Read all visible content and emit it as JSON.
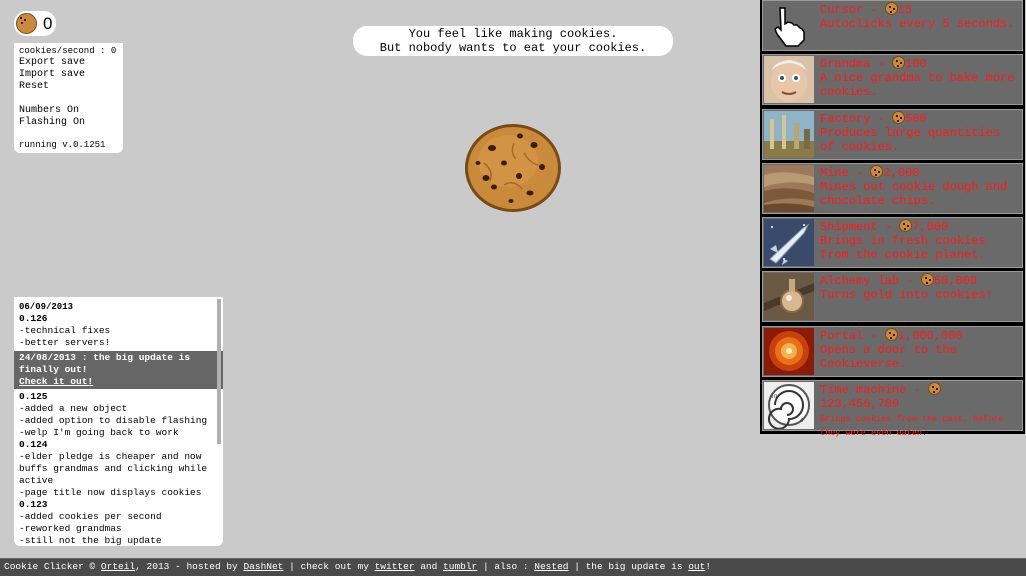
{
  "counter": {
    "value": "0"
  },
  "menu": {
    "cps": "cookies/second : 0",
    "export": "Export save",
    "import": "Import save",
    "reset": "Reset",
    "numbers": "Numbers On",
    "flashing": "Flashing On",
    "version": "running v.0.1251"
  },
  "message": {
    "line1": "You feel like making cookies.",
    "line2": "But nobody wants to eat your cookies."
  },
  "log": {
    "date": "06/09/2013",
    "v126": "0.126",
    "l1": "-technical fixes",
    "l2": "-better servers!",
    "hl_text": "24/08/2013 : the big update is finally out!",
    "hl_link": "Check it out!",
    "v125": "0.125",
    "l3": "-added a new object",
    "l4": "-added option to disable flashing",
    "l5": "-welp I'm going back to work",
    "v124": "0.124",
    "l6": "-elder pledge is cheaper and now buffs grandmas and clicking while active",
    "l7": "-page title now displays cookies",
    "v123": "0.123",
    "l8": "-added cookies per second",
    "l9": "-reworked grandmas",
    "l10": "-still not the big update"
  },
  "store": [
    {
      "name": "Cursor",
      "price": "15",
      "desc": "Autoclicks every 5 seconds.",
      "icon": "cursor-hand-icon",
      "small": false
    },
    {
      "name": "Grandma",
      "price": "100",
      "desc": "A nice grandma to bake more cookies.",
      "icon": "grandma-portrait",
      "small": false
    },
    {
      "name": "Factory",
      "price": "500",
      "desc": "Produces large quantities of cookies.",
      "icon": "factory-picture",
      "small": false
    },
    {
      "name": "Mine",
      "price": "2,000",
      "desc": "Mines out cookie dough and chocolate chips.",
      "icon": "mine-picture",
      "small": false
    },
    {
      "name": "Shipment",
      "price": "7,000",
      "desc": "Brings in fresh cookies from the cookie planet.",
      "icon": "shipment-rocket-picture",
      "small": false
    },
    {
      "name": "Alchemy lab",
      "price": "50,000",
      "desc": "Turns gold into cookies!",
      "icon": "alchemy-flask-picture",
      "small": false
    },
    {
      "name": "Portal",
      "price": "1,000,000",
      "desc": "Opens a door to the Cookieverse.",
      "icon": "portal-vortex-picture",
      "small": false
    },
    {
      "name": "Time machine",
      "price": "123,456,789",
      "desc": "Brings cookies from the past, before they were even eaten.",
      "icon": "time-machine-clock-picture",
      "small": true
    }
  ],
  "footer": {
    "t1": "Cookie Clicker © ",
    "orteil": "Orteil",
    "t2": ", 2013 - hosted by ",
    "dashnet": "DashNet",
    "t3": " | check out my ",
    "twitter": "twitter",
    "t4": " and ",
    "tumblr": "tumblr",
    "t5": " | also : ",
    "nested": "Nested",
    "t6": " | the big update is ",
    "out": "out",
    "t7": "!"
  },
  "colors": {
    "background": "#cacaca",
    "store_text": "#ff1a1a",
    "store_button": "#6a6a6a",
    "footer": "#4a4a4a"
  }
}
